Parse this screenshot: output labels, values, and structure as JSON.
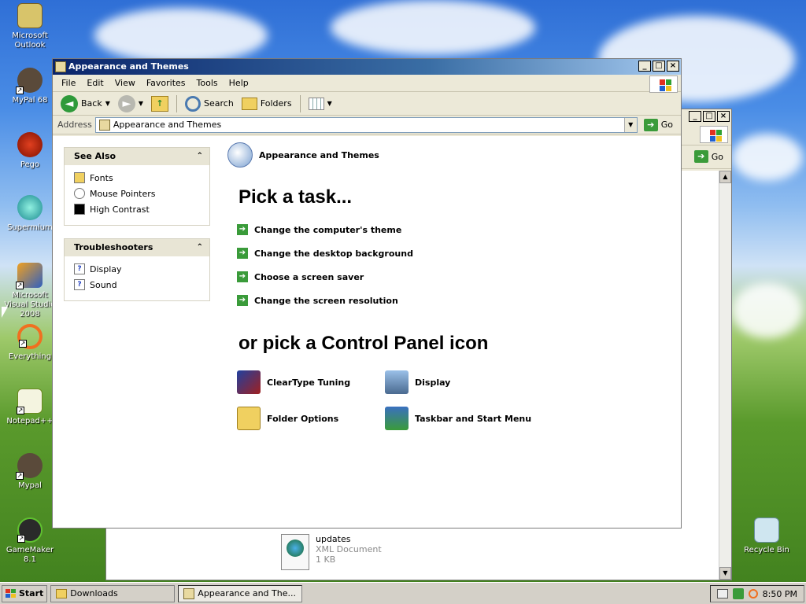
{
  "desktop": {
    "icons": [
      {
        "label": "Microsoft Outlook",
        "icon": "outlook-icon"
      },
      {
        "label": "MyPal 68",
        "icon": "mypal-icon"
      },
      {
        "label": "Pego",
        "icon": "pego-icon"
      },
      {
        "label": "Supermium",
        "icon": "supermium-icon"
      },
      {
        "label": "Microsoft Visual Studio 2008",
        "icon": "visual-studio-icon"
      },
      {
        "label": "Everything",
        "icon": "everything-icon"
      },
      {
        "label": "Notepad++",
        "icon": "notepadpp-icon"
      },
      {
        "label": "Mypal",
        "icon": "mypal-icon"
      },
      {
        "label": "GameMaker 8.1",
        "icon": "gamemaker-icon"
      },
      {
        "label": "Recycle Bin",
        "icon": "recycle-bin-icon"
      }
    ]
  },
  "back_window": {
    "go_label": "Go",
    "file": {
      "name": "updates",
      "type": "XML Document",
      "size": "1 KB"
    }
  },
  "window": {
    "title": "Appearance and Themes",
    "menu": [
      "File",
      "Edit",
      "View",
      "Favorites",
      "Tools",
      "Help"
    ],
    "toolbar": {
      "back": "Back",
      "search": "Search",
      "folders": "Folders"
    },
    "address": {
      "label": "Address",
      "value": "Appearance and Themes",
      "go": "Go"
    },
    "see_also": {
      "title": "See Also",
      "items": [
        "Fonts",
        "Mouse Pointers",
        "High Contrast"
      ]
    },
    "troubleshooters": {
      "title": "Troubleshooters",
      "items": [
        "Display",
        "Sound"
      ]
    },
    "header": "Appearance and Themes",
    "pick_task": "Pick a task...",
    "tasks": [
      "Change the computer's theme",
      "Change the desktop background",
      "Choose a screen saver",
      "Change the screen resolution"
    ],
    "pick_icon": "or pick a Control Panel icon",
    "cp_icons": [
      "ClearType Tuning",
      "Display",
      "Folder Options",
      "Taskbar and Start Menu"
    ]
  },
  "taskbar": {
    "start": "Start",
    "buttons": [
      "Downloads",
      "Appearance and The..."
    ],
    "clock": "8:50 PM"
  }
}
